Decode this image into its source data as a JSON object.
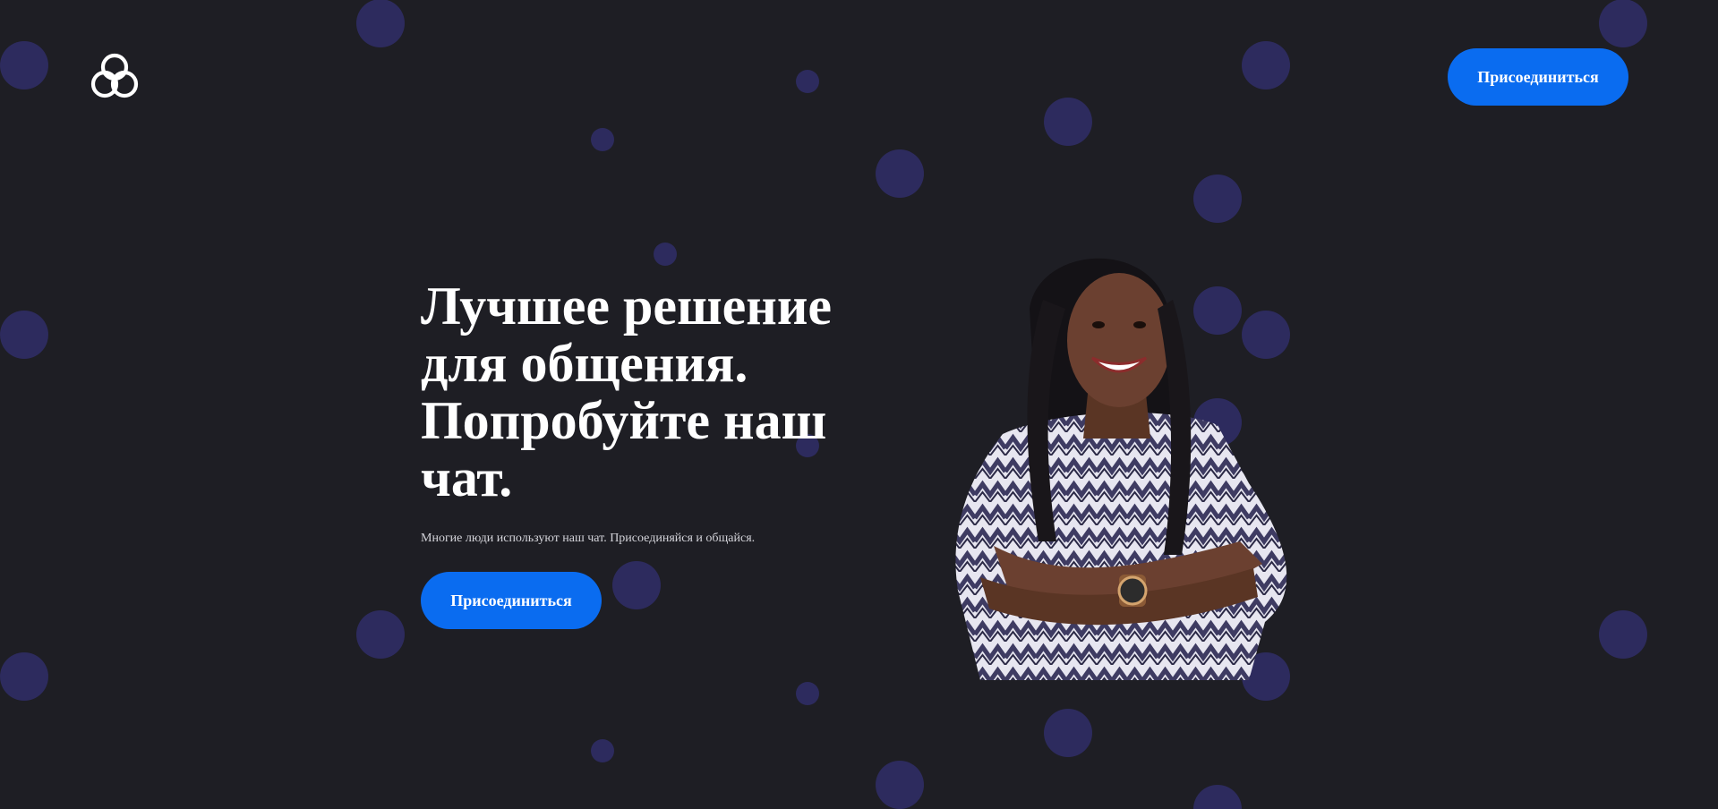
{
  "header": {
    "logo_icon": "linked-rings-logo-icon",
    "join_label": "Присоединиться"
  },
  "hero": {
    "title_lines": [
      "Лучшее решение",
      "для общения.",
      "Попробуйте наш",
      "чат."
    ],
    "subtitle": "Многие люди используют наш чат. Присоединяйся и общайся.",
    "join_label": "Присоединиться",
    "image_icon": "smiling-woman-portrait"
  },
  "colors": {
    "background": "#1e1e24",
    "dot": "#2d2b5e",
    "accent": "#0a6cf0",
    "text": "#ffffff"
  }
}
